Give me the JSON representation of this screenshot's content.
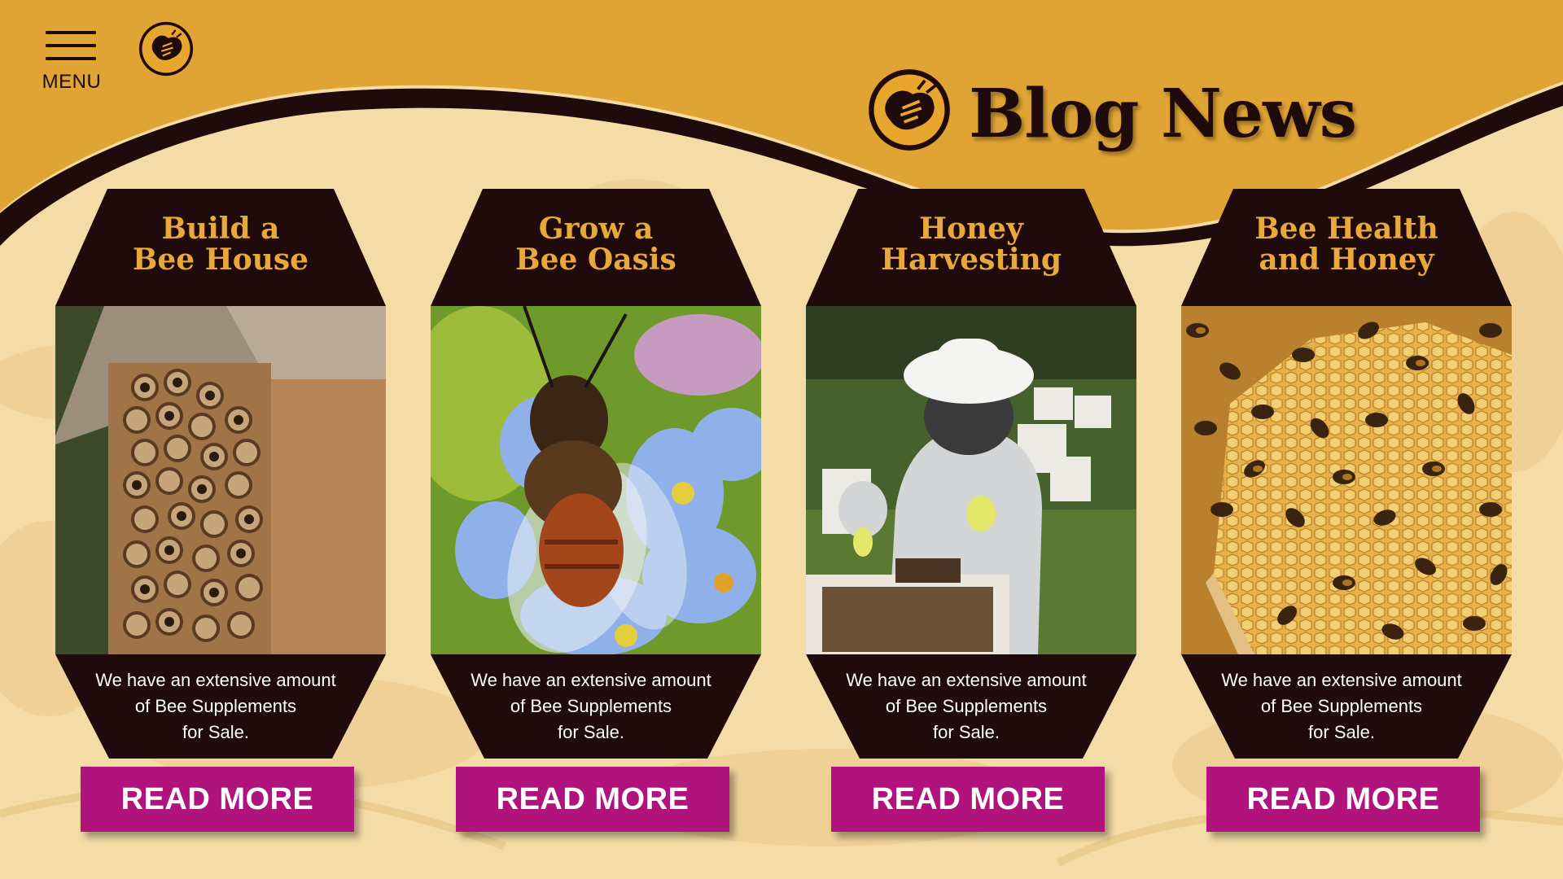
{
  "app": {
    "menu_label": "MENU",
    "page_title": "Blog News",
    "colors": {
      "header": "#e0a434",
      "dark": "#1f0a0c",
      "gold_text": "#e8a83a",
      "button": "#b0137c",
      "background": "#f5dca6"
    },
    "icons": [
      "menu-icon",
      "bee-logo-icon"
    ]
  },
  "cards": [
    {
      "title_line1": "Build a",
      "title_line2": "Bee House",
      "image": "bee-house-photo",
      "description": "We have an extensive amount\nof Bee Supplements\nfor Sale.",
      "button": "READ MORE"
    },
    {
      "title_line1": "Grow a",
      "title_line2": "Bee Oasis",
      "image": "bee-on-flower-photo",
      "description": "We have an extensive amount\nof Bee Supplements\nfor Sale.",
      "button": "READ MORE"
    },
    {
      "title_line1": "Honey",
      "title_line2": "Harvesting",
      "image": "beekeeper-photo",
      "description": "We have an extensive amount\nof Bee Supplements\nfor Sale.",
      "button": "READ MORE"
    },
    {
      "title_line1": "Bee Health",
      "title_line2": "and Honey",
      "image": "honeycomb-bees-photo",
      "description": "We have an extensive amount\nof Bee Supplements\nfor Sale.",
      "button": "READ MORE"
    }
  ]
}
